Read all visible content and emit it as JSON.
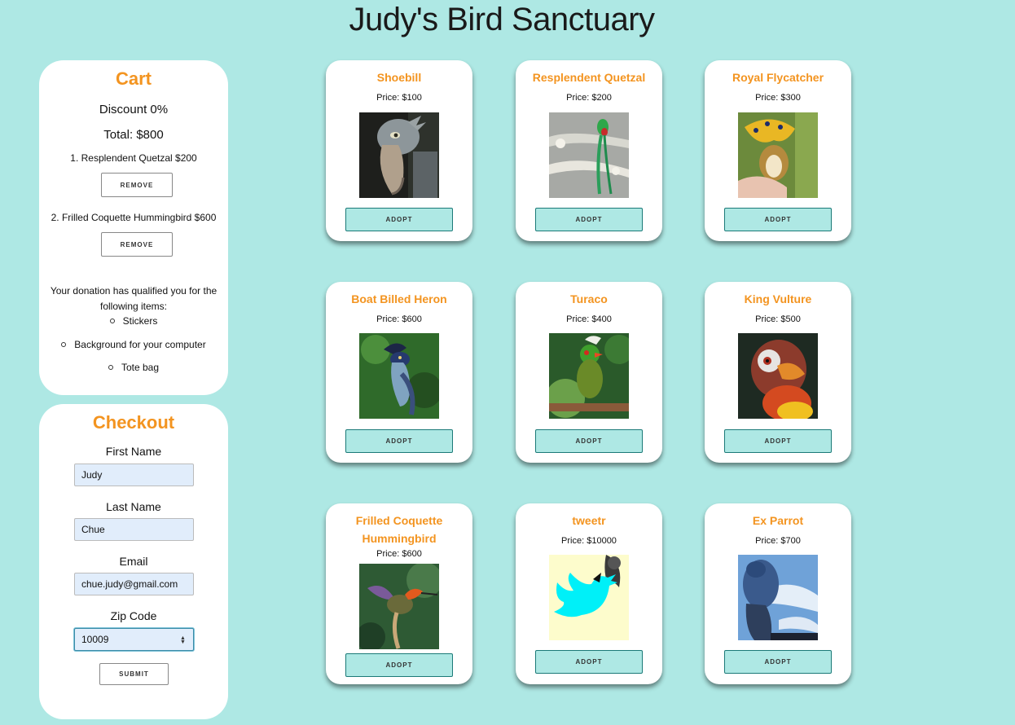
{
  "title": "Judy's Bird Sanctuary",
  "cart": {
    "heading": "Cart",
    "discount": "Discount 0%",
    "total": "Total: $800",
    "items": [
      {
        "label": "1. Resplendent Quetzal $200",
        "button": "REMOVE"
      },
      {
        "label": "2. Frilled Coquette Hummingbird $600",
        "button": "REMOVE"
      }
    ],
    "perks_intro": "Your donation has qualified you for the following items:",
    "perks": [
      "Stickers",
      "Background for your computer",
      "Tote bag"
    ]
  },
  "checkout": {
    "heading": "Checkout",
    "first_name_label": "First Name",
    "first_name_value": "Judy",
    "last_name_label": "Last Name",
    "last_name_value": "Chue",
    "email_label": "Email",
    "email_value": "chue.judy@gmail.com",
    "zip_label": "Zip Code",
    "zip_value": "10009",
    "submit_label": "SUBMIT"
  },
  "birds": [
    {
      "name": "Shoebill",
      "price": "Price: $100",
      "button": "ADOPT",
      "image": "shoebill-photo"
    },
    {
      "name": "Resplendent Quetzal",
      "price": "Price: $200",
      "button": "ADOPT",
      "image": "quetzal-photo"
    },
    {
      "name": "Royal Flycatcher",
      "price": "Price: $300",
      "button": "ADOPT",
      "image": "flycatcher-photo"
    },
    {
      "name": "Boat Billed Heron",
      "price": "Price: $600",
      "button": "ADOPT",
      "image": "heron-photo"
    },
    {
      "name": "Turaco",
      "price": "Price: $400",
      "button": "ADOPT",
      "image": "turaco-photo"
    },
    {
      "name": "King Vulture",
      "price": "Price: $500",
      "button": "ADOPT",
      "image": "vulture-photo"
    },
    {
      "name": "Frilled Coquette Hummingbird",
      "price": "Price: $600",
      "button": "ADOPT",
      "image": "hummingbird-photo"
    },
    {
      "name": "tweetr",
      "price": "Price: $10000",
      "button": "ADOPT",
      "image": "tweetr-illustration"
    },
    {
      "name": "Ex Parrot",
      "price": "Price: $700",
      "button": "ADOPT",
      "image": "parrot-photo"
    }
  ],
  "colors": {
    "background": "#aee8e4",
    "accent": "#f39420",
    "button_border": "#1b7a78"
  }
}
